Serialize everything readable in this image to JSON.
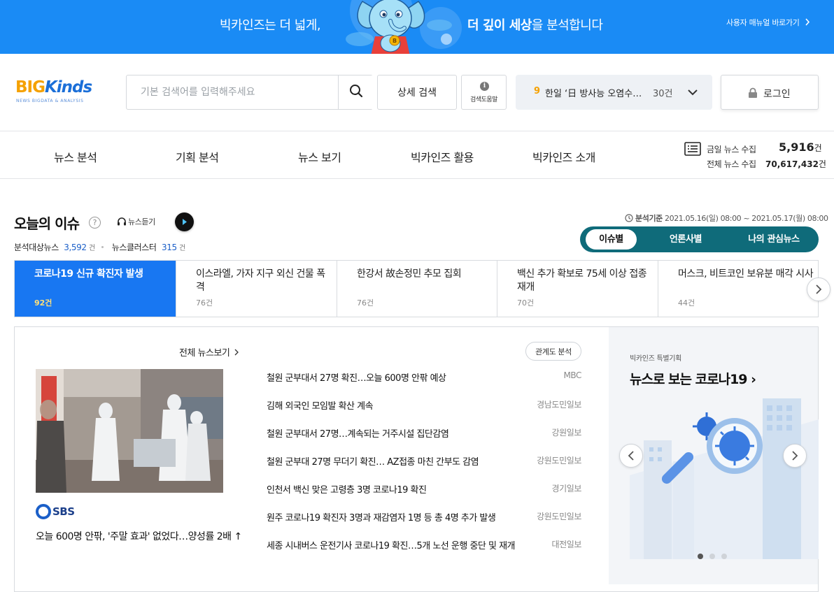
{
  "banner": {
    "text_left": "빅카인즈는 더 넓게,",
    "text_right_bold": "더 깊이 세상",
    "text_right_rest": "을 분석합니다",
    "manual_link": "사용자 매뉴얼 바로가기",
    "mascot_badge": "B",
    "background_color": "#1a8bf5"
  },
  "header": {
    "logo_big": "BIG",
    "logo_kinds": "Kinds",
    "logo_sub": "NEWS BIGDATA & ANALYSIS",
    "search_placeholder": "기본 검색어를 입력해주세요",
    "search_value": "",
    "search_icon": "search-icon",
    "detail_search_label": "상세 검색",
    "help_icon_text": "i",
    "help_label": "검색도움말",
    "trend": {
      "rank": "9",
      "keyword": "한일 ‘日 방사능 오염수’ 갈등",
      "count": "30건"
    },
    "login_label": "로그인"
  },
  "nav": {
    "items": [
      "뉴스 분석",
      "기획 분석",
      "뉴스 보기",
      "빅카인즈 활용",
      "빅카인즈 소개"
    ],
    "today_label": "금일 뉴스 수집",
    "today_value": "5,916",
    "today_unit": "건",
    "total_label": "전체 뉴스 수집",
    "total_value": "70,617,432",
    "total_unit": "건"
  },
  "issue": {
    "title": "오늘의 이슈",
    "help_icon": "?",
    "listen_label": "뉴스듣기",
    "target_news_label": "분석대상뉴스",
    "target_news_value": "3,592",
    "target_news_unit": "건",
    "cluster_label": "뉴스클러스터",
    "cluster_value": "315",
    "cluster_unit": "건",
    "basis_label": "분석기준",
    "basis_period": "2021.05.16(일) 08:00 ~ 2021.05.17(월) 08:00",
    "segments": [
      "이슈별",
      "언론사별",
      "나의 관심뉴스"
    ],
    "active_segment": "이슈별",
    "tabs": [
      {
        "title": "코로나19 신규 확진자 발생",
        "count": "92건",
        "active": true
      },
      {
        "title": "이스라엘, 가자 지구 외신 건물 폭격",
        "count": "76건",
        "active": false
      },
      {
        "title": "한강서 故손정민 추모 집회",
        "count": "76건",
        "active": false
      },
      {
        "title": "백신 추가 확보로 75세 이상 접종 재개",
        "count": "70건",
        "active": false
      },
      {
        "title": "머스크, 비트코인 보유분 매각 시사",
        "count": "44건",
        "active": false
      }
    ]
  },
  "panel": {
    "all_news_label": "전체 뉴스보기",
    "relation_label": "관계도 분석",
    "photo_source": "SBS",
    "photo_caption": "오늘 600명 안팎, '주말 효과' 없었다…양성률 2배 ↑",
    "news": [
      {
        "headline": "철원 군부대서 27명 확진…오늘 600명 안팎 예상",
        "press": "MBC"
      },
      {
        "headline": "김해 외국인 모임발 확산 계속",
        "press": "경남도민일보"
      },
      {
        "headline": "철원 군부대서 27명…계속되는 거주시설 집단감염",
        "press": "강원일보"
      },
      {
        "headline": "철원 군부대 27명 무더기 확진… AZ접종 마친 간부도 감염",
        "press": "강원도민일보"
      },
      {
        "headline": "인천서 백신 맞은 고령층 3명 코로나19 확진",
        "press": "경기일보"
      },
      {
        "headline": "원주 코로나19 확진자 3명과 재감염자 1명 등 총 4명 추가 발생",
        "press": "강원도민일보"
      },
      {
        "headline": "세종 시내버스 운전기사 코로나19 확진…5개 노선 운행 중단 및 재개",
        "press": "대전일보"
      }
    ]
  },
  "special": {
    "small_label": "빅카인즈 특별기획",
    "title": "뉴스로 보는 코로나19",
    "title_arrow": "›",
    "slides_total": 3,
    "slide_active": 1
  }
}
